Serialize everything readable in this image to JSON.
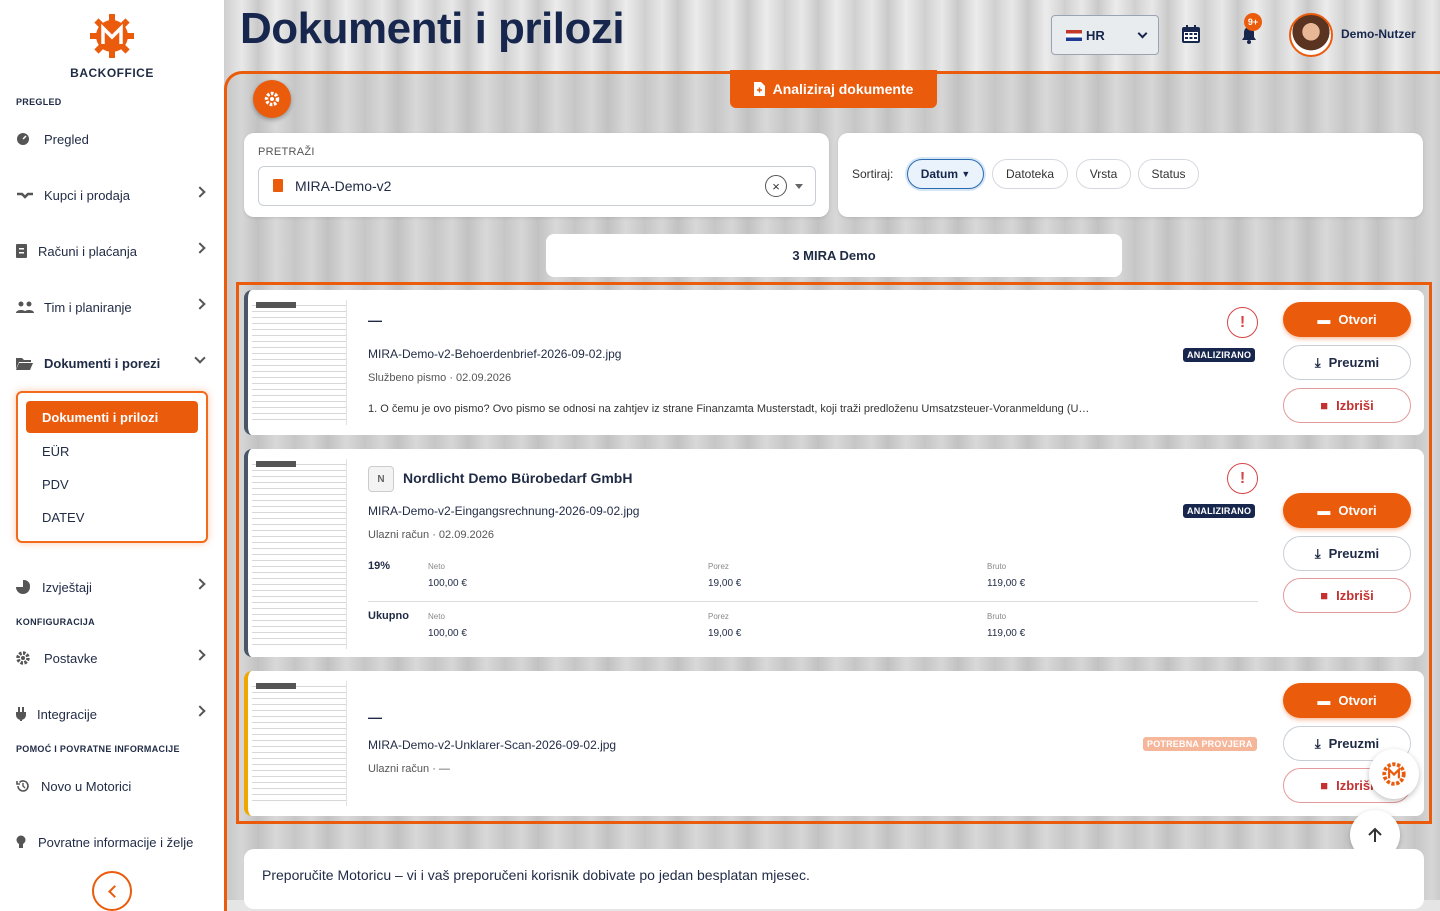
{
  "app": {
    "brand": "BACKOFFICE",
    "page_title": "Dokumenti i prilozi"
  },
  "sidebar": {
    "sections": {
      "overview": "PREGLED",
      "config": "KONFIGURACIJA",
      "help": "POMOĆ I POVRATNE INFORMACIJE"
    },
    "items": [
      {
        "label": "Pregled",
        "icon": "dashboard-icon"
      },
      {
        "label": "Kupci i prodaja",
        "icon": "handshake-icon"
      },
      {
        "label": "Računi i plaćanja",
        "icon": "invoice-icon"
      },
      {
        "label": "Tim i planiranje",
        "icon": "team-icon"
      },
      {
        "label": "Dokumenti i porezi",
        "icon": "folder-open-icon"
      },
      {
        "label": "Izvještaji",
        "icon": "pie-chart-icon"
      },
      {
        "label": "Postavke",
        "icon": "gear-icon"
      },
      {
        "label": "Integracije",
        "icon": "plug-icon"
      },
      {
        "label": "Novo u Motorici",
        "icon": "history-icon"
      },
      {
        "label": "Povratne informacije i želje",
        "icon": "lightbulb-icon"
      }
    ],
    "submenu": [
      "Dokumenti i prilozi",
      "EÜR",
      "PDV",
      "DATEV"
    ]
  },
  "header": {
    "language": "HR",
    "notifications_badge": "9+",
    "user_name": "Demo-Nutzer"
  },
  "toolbar": {
    "analyze_label": "Analiziraj dokumente"
  },
  "search": {
    "label": "PRETRAŽI",
    "value": "MIRA-Demo-v2",
    "clear": "×"
  },
  "sort": {
    "label": "Sortiraj:",
    "options": [
      "Datum",
      "Datoteka",
      "Vrsta",
      "Status"
    ],
    "active": "Datum",
    "active_arrow": "▼"
  },
  "group": {
    "label": "3 MIRA Demo"
  },
  "documents": [
    {
      "title": "—",
      "file": "MIRA-Demo-v2-Behoerdenbrief-2026-09-02.jpg",
      "meta": "Službeno pismo · 02.09.2026",
      "status": "ANALIZIRANO",
      "desc": "1. O čemu je ovo pismo? Ovo pismo se odnosi na zahtjev iz strane Finanzamta Musterstadt, koji traži predloženu Umsatzsteuer-Voranmeldung (U…"
    },
    {
      "title": "Nordlicht Demo Bürobedarf GmbH",
      "initial": "N",
      "file": "MIRA-Demo-v2-Eingangsrechnung-2026-09-02.jpg",
      "meta": "Ulazni račun · 02.09.2026",
      "status": "ANALIZIRANO",
      "tax_rows": [
        {
          "label": "19%",
          "neto_k": "Neto",
          "neto": "100,00 €",
          "porez_k": "Porez",
          "porez": "19,00 €",
          "bruto_k": "Bruto",
          "bruto": "119,00 €"
        },
        {
          "label": "Ukupno",
          "neto_k": "Neto",
          "neto": "100,00 €",
          "porez_k": "Porez",
          "porez": "19,00 €",
          "bruto_k": "Bruto",
          "bruto": "119,00 €"
        }
      ]
    },
    {
      "title": "—",
      "file": "MIRA-Demo-v2-Unklarer-Scan-2026-09-02.jpg",
      "meta": "Ulazni račun · —",
      "status": "POTREBNA PROVJERA"
    }
  ],
  "actions": {
    "open": "Otvori",
    "download": "Preuzmi",
    "delete": "Izbriši",
    "alert": "!"
  },
  "promo": {
    "text": "Preporučite Motoricu – vi i vaš preporučeni korisnik dobivate po jedan besplatan mjesec."
  },
  "colors": {
    "accent": "#ea5b0c",
    "navy": "#16264d",
    "danger": "#c53030"
  }
}
